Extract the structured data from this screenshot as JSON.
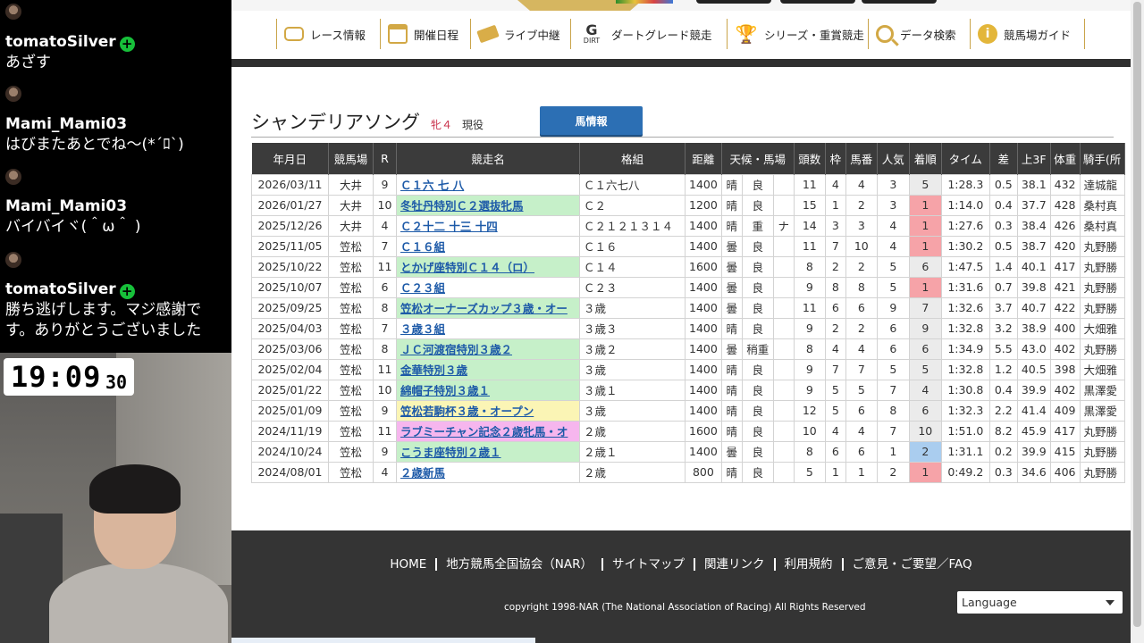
{
  "chat": {
    "messages": [
      {
        "user": "tomatoSilver",
        "verified": true,
        "text": "あざす"
      },
      {
        "user": "Mami_Mami03",
        "verified": false,
        "text": "はびまたあとでね〜(*´ﾛ`)"
      },
      {
        "user": "Mami_Mami03",
        "verified": false,
        "text": "バイバイヾ(＾ω＾ )"
      },
      {
        "user": "tomatoSilver",
        "verified": true,
        "text": "勝ち逃げします。マジ感謝です。ありがとうございました"
      }
    ]
  },
  "clock": {
    "hm": "19:09",
    "sec": "30"
  },
  "nav": {
    "items": [
      {
        "label": "レース情報",
        "icon": "race-info-icon"
      },
      {
        "label": "開催日程",
        "icon": "calendar-icon"
      },
      {
        "label": "ライブ中継",
        "icon": "live-ticket-icon"
      },
      {
        "label": "ダートグレード競走",
        "icon": "dirt-grade-icon"
      },
      {
        "label": "シリーズ・重賞競走",
        "icon": "trophy-icon"
      },
      {
        "label": "データ検索",
        "icon": "search-icon"
      },
      {
        "label": "競馬場ガイド",
        "icon": "info-icon"
      }
    ]
  },
  "horse": {
    "name": "シャンデリアソング",
    "sex_age": "牝４",
    "status": "現役",
    "button": "馬情報"
  },
  "table": {
    "headers": [
      "年月日",
      "競馬場",
      "R",
      "競走名",
      "格組",
      "距離",
      "天候・馬場",
      "頭数",
      "枠",
      "馬番",
      "人気",
      "着順",
      "タイム",
      "差",
      "上3F",
      "体重",
      "騎手(所"
    ],
    "rows": [
      {
        "date": "2026/03/11",
        "track": "大井",
        "r": "9",
        "race": "Ｃ１六 七 八",
        "hl": "",
        "cls": "Ｃ１六七八",
        "dist": "1400",
        "weather": "晴",
        "going": "良",
        "note": "",
        "runners": "11",
        "gate": "4",
        "num": "4",
        "pop": "3",
        "fin": "5",
        "time": "1:28.3",
        "diff": "0.5",
        "f3": "38.1",
        "wt": "432",
        "jockey": "達城龍"
      },
      {
        "date": "2026/01/27",
        "track": "大井",
        "r": "10",
        "race": "冬牡丹特別Ｃ２選抜牝馬",
        "hl": "green",
        "cls": "Ｃ２",
        "dist": "1200",
        "weather": "晴",
        "going": "良",
        "note": "",
        "runners": "15",
        "gate": "1",
        "num": "2",
        "pop": "3",
        "fin": "1",
        "time": "1:14.0",
        "diff": "0.4",
        "f3": "37.7",
        "wt": "428",
        "jockey": "桑村真"
      },
      {
        "date": "2025/12/26",
        "track": "大井",
        "r": "4",
        "race": "Ｃ２十二 十三 十四",
        "hl": "",
        "cls": "Ｃ２１２１３１４",
        "dist": "1400",
        "weather": "晴",
        "going": "重",
        "note": "ナ",
        "runners": "14",
        "gate": "3",
        "num": "3",
        "pop": "4",
        "fin": "1",
        "time": "1:27.6",
        "diff": "0.3",
        "f3": "38.4",
        "wt": "426",
        "jockey": "桑村真"
      },
      {
        "date": "2025/11/05",
        "track": "笠松",
        "r": "7",
        "race": "Ｃ１６組",
        "hl": "",
        "cls": "Ｃ１６",
        "dist": "1400",
        "weather": "曇",
        "going": "良",
        "note": "",
        "runners": "11",
        "gate": "7",
        "num": "10",
        "pop": "4",
        "fin": "1",
        "time": "1:30.2",
        "diff": "0.5",
        "f3": "38.7",
        "wt": "420",
        "jockey": "丸野勝"
      },
      {
        "date": "2025/10/22",
        "track": "笠松",
        "r": "11",
        "race": "とかげ座特別Ｃ１４（ロ）",
        "hl": "green",
        "cls": "Ｃ１４",
        "dist": "1600",
        "weather": "曇",
        "going": "良",
        "note": "",
        "runners": "8",
        "gate": "2",
        "num": "2",
        "pop": "5",
        "fin": "6",
        "time": "1:47.5",
        "diff": "1.4",
        "f3": "40.1",
        "wt": "417",
        "jockey": "丸野勝"
      },
      {
        "date": "2025/10/07",
        "track": "笠松",
        "r": "6",
        "race": "Ｃ２３組",
        "hl": "",
        "cls": "Ｃ２３",
        "dist": "1400",
        "weather": "曇",
        "going": "良",
        "note": "",
        "runners": "9",
        "gate": "8",
        "num": "8",
        "pop": "5",
        "fin": "1",
        "time": "1:31.6",
        "diff": "0.7",
        "f3": "39.8",
        "wt": "421",
        "jockey": "丸野勝"
      },
      {
        "date": "2025/09/25",
        "track": "笠松",
        "r": "8",
        "race": "笠松オーナーズカップ３歳・オー",
        "hl": "green",
        "cls": "３歳",
        "dist": "1400",
        "weather": "曇",
        "going": "良",
        "note": "",
        "runners": "11",
        "gate": "6",
        "num": "6",
        "pop": "9",
        "fin": "7",
        "time": "1:32.6",
        "diff": "3.7",
        "f3": "40.7",
        "wt": "422",
        "jockey": "丸野勝"
      },
      {
        "date": "2025/04/03",
        "track": "笠松",
        "r": "7",
        "race": "３歳３組",
        "hl": "",
        "cls": "３歳３",
        "dist": "1400",
        "weather": "晴",
        "going": "良",
        "note": "",
        "runners": "9",
        "gate": "2",
        "num": "2",
        "pop": "6",
        "fin": "9",
        "time": "1:32.8",
        "diff": "3.2",
        "f3": "38.9",
        "wt": "400",
        "jockey": "大畑雅"
      },
      {
        "date": "2025/03/06",
        "track": "笠松",
        "r": "8",
        "race": "ＪＣ河渡宿特別３歳２",
        "hl": "green",
        "cls": "３歳２",
        "dist": "1400",
        "weather": "曇",
        "going": "稍重",
        "note": "",
        "runners": "8",
        "gate": "4",
        "num": "4",
        "pop": "6",
        "fin": "6",
        "time": "1:34.9",
        "diff": "5.5",
        "f3": "43.0",
        "wt": "402",
        "jockey": "丸野勝"
      },
      {
        "date": "2025/02/04",
        "track": "笠松",
        "r": "11",
        "race": "金華特別３歳",
        "hl": "green",
        "cls": "３歳",
        "dist": "1400",
        "weather": "晴",
        "going": "良",
        "note": "",
        "runners": "9",
        "gate": "7",
        "num": "7",
        "pop": "5",
        "fin": "5",
        "time": "1:32.8",
        "diff": "1.2",
        "f3": "40.5",
        "wt": "398",
        "jockey": "大畑雅"
      },
      {
        "date": "2025/01/22",
        "track": "笠松",
        "r": "10",
        "race": "綿帽子特別３歳１",
        "hl": "green",
        "cls": "３歳１",
        "dist": "1400",
        "weather": "晴",
        "going": "良",
        "note": "",
        "runners": "9",
        "gate": "5",
        "num": "5",
        "pop": "7",
        "fin": "4",
        "time": "1:30.8",
        "diff": "0.4",
        "f3": "39.9",
        "wt": "402",
        "jockey": "黒澤愛"
      },
      {
        "date": "2025/01/09",
        "track": "笠松",
        "r": "9",
        "race": "笠松若駒杯３歳・オープン",
        "hl": "yellow",
        "cls": "３歳",
        "dist": "1400",
        "weather": "晴",
        "going": "良",
        "note": "",
        "runners": "12",
        "gate": "5",
        "num": "6",
        "pop": "8",
        "fin": "6",
        "time": "1:32.3",
        "diff": "2.2",
        "f3": "41.4",
        "wt": "409",
        "jockey": "黒澤愛"
      },
      {
        "date": "2024/11/19",
        "track": "笠松",
        "r": "11",
        "race": "ラブミーチャン記念２歳牝馬・オ",
        "hl": "pink",
        "cls": "２歳",
        "dist": "1600",
        "weather": "晴",
        "going": "良",
        "note": "",
        "runners": "10",
        "gate": "4",
        "num": "4",
        "pop": "7",
        "fin": "10",
        "time": "1:51.0",
        "diff": "8.2",
        "f3": "45.9",
        "wt": "417",
        "jockey": "丸野勝"
      },
      {
        "date": "2024/10/24",
        "track": "笠松",
        "r": "9",
        "race": "こうま座特別２歳１",
        "hl": "green",
        "cls": "２歳１",
        "dist": "1400",
        "weather": "曇",
        "going": "良",
        "note": "",
        "runners": "8",
        "gate": "6",
        "num": "6",
        "pop": "1",
        "fin": "2",
        "time": "1:31.1",
        "diff": "0.2",
        "f3": "39.9",
        "wt": "415",
        "jockey": "丸野勝"
      },
      {
        "date": "2024/08/01",
        "track": "笠松",
        "r": "4",
        "race": "２歳新馬",
        "hl": "",
        "cls": "２歳",
        "dist": "800",
        "weather": "晴",
        "going": "良",
        "note": "",
        "runners": "5",
        "gate": "1",
        "num": "1",
        "pop": "2",
        "fin": "1",
        "time": "0:49.2",
        "diff": "0.3",
        "f3": "34.6",
        "wt": "406",
        "jockey": "丸野勝"
      }
    ]
  },
  "footer": {
    "links": [
      "HOME",
      "地方競馬全国協会（NAR）",
      "サイトマップ",
      "関連リンク",
      "利用規約",
      "ご意見・ご要望／FAQ"
    ],
    "copyright": "copyright 1998-NAR (The National Association of Racing) All Rights Reserved",
    "language": "Language"
  },
  "colors": {
    "header_bg": "#3b3b3b",
    "button_blue": "#2c6fb4",
    "win_red": "#f6a3a8",
    "second_blue": "#aacdef",
    "race_green": "#c6f0c9",
    "nav_gold": "#c9a44a"
  }
}
